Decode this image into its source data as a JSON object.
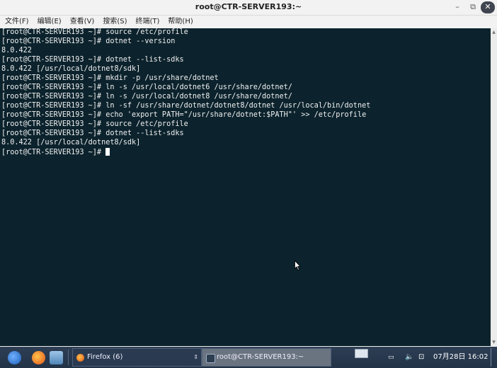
{
  "window": {
    "title": "root@CTR-SERVER193:~"
  },
  "window_controls": {
    "minimize": "–",
    "maximize": "⧉",
    "close": "✕"
  },
  "menu": [
    "文件(F)",
    "编辑(E)",
    "查看(V)",
    "搜索(S)",
    "终端(T)",
    "帮助(H)"
  ],
  "terminal": {
    "lines": [
      "[root@CTR-SERVER193 ~]# source /etc/profile",
      "[root@CTR-SERVER193 ~]# dotnet --version",
      "8.0.422",
      "[root@CTR-SERVER193 ~]# dotnet --list-sdks",
      "8.0.422 [/usr/local/dotnet8/sdk]",
      "[root@CTR-SERVER193 ~]# mkdir -p /usr/share/dotnet",
      "[root@CTR-SERVER193 ~]# ln -s /usr/local/dotnet6 /usr/share/dotnet/",
      "[root@CTR-SERVER193 ~]# ln -s /usr/local/dotnet8 /usr/share/dotnet/",
      "[root@CTR-SERVER193 ~]# ln -sf /usr/share/dotnet/dotnet8/dotnet /usr/local/bin/dotnet",
      "[root@CTR-SERVER193 ~]# echo 'export PATH=\"/usr/share/dotnet:$PATH\"' >> /etc/profile",
      "[root@CTR-SERVER193 ~]# source /etc/profile",
      "[root@CTR-SERVER193 ~]# dotnet --list-sdks",
      "8.0.422 [/usr/local/dotnet8/sdk]"
    ],
    "prompt": "[root@CTR-SERVER193 ~]# "
  },
  "taskbar": {
    "tasks": [
      {
        "label": "Firefox (6)"
      },
      {
        "label": "root@CTR-SERVER193:~"
      }
    ],
    "clock": "07月28日 16:02",
    "colors": {
      "panel": "#2a3a50",
      "active_task": "#6a7380"
    }
  },
  "colors": {
    "terminal_bg": "#0c232d",
    "terminal_fg": "#f0f0f0"
  }
}
